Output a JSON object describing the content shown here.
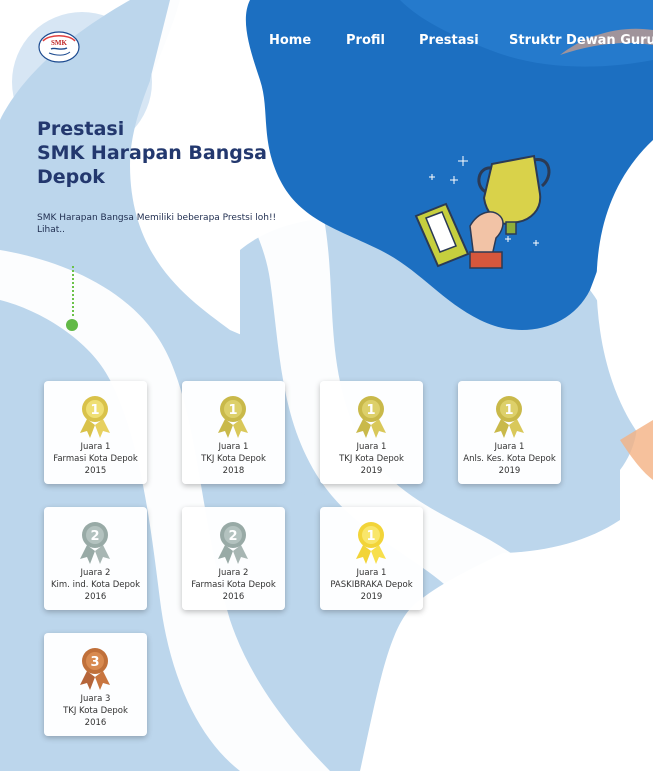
{
  "nav": {
    "items": [
      {
        "label": "Home"
      },
      {
        "label": "Profil"
      },
      {
        "label": "Prestasi"
      },
      {
        "label": "Struktr Dewan Guru"
      }
    ]
  },
  "logo": {
    "text": "SMK"
  },
  "hero": {
    "title_lines": [
      "Prestasi",
      "SMK Harapan Bangsa",
      "Depok"
    ],
    "subtitle": "SMK Harapan Bangsa Memiliki beberapa Prestsi loh!! Lihat.."
  },
  "achievements": [
    {
      "rank": "Juara 1",
      "field": "Farmasi Kota Depok",
      "year": "2015",
      "medal": "1"
    },
    {
      "rank": "Juara 1",
      "field": "TKJ Kota Depok",
      "year": "2018",
      "medal": "1"
    },
    {
      "rank": "Juara 1",
      "field": "TKJ Kota Depok",
      "year": "2019",
      "medal": "1"
    },
    {
      "rank": "Juara 1",
      "field": "Anls. Kes. Kota Depok",
      "year": "2019",
      "medal": "1"
    },
    {
      "rank": "Juara 2",
      "field": "Kim. ind. Kota Depok",
      "year": "2016",
      "medal": "2"
    },
    {
      "rank": "Juara 2",
      "field": "Farmasi Kota Depok",
      "year": "2016",
      "medal": "2"
    },
    {
      "rank": "Juara 1",
      "field": "PASKIBRAKA Depok",
      "year": "2019",
      "medal": "1"
    },
    {
      "rank": "Juara 3",
      "field": "TKJ Kota Depok",
      "year": "2016",
      "medal": "3"
    }
  ],
  "colors": {
    "accent_blue": "#1c6fc1",
    "light_blue": "#bcd6ec",
    "title": "#23386e",
    "gold": "#d9c24a",
    "silver": "#a7b6b3",
    "bronze": "#c0703a"
  },
  "icons": [
    "logo-emblem",
    "trophy-illustration",
    "medal-icon"
  ]
}
